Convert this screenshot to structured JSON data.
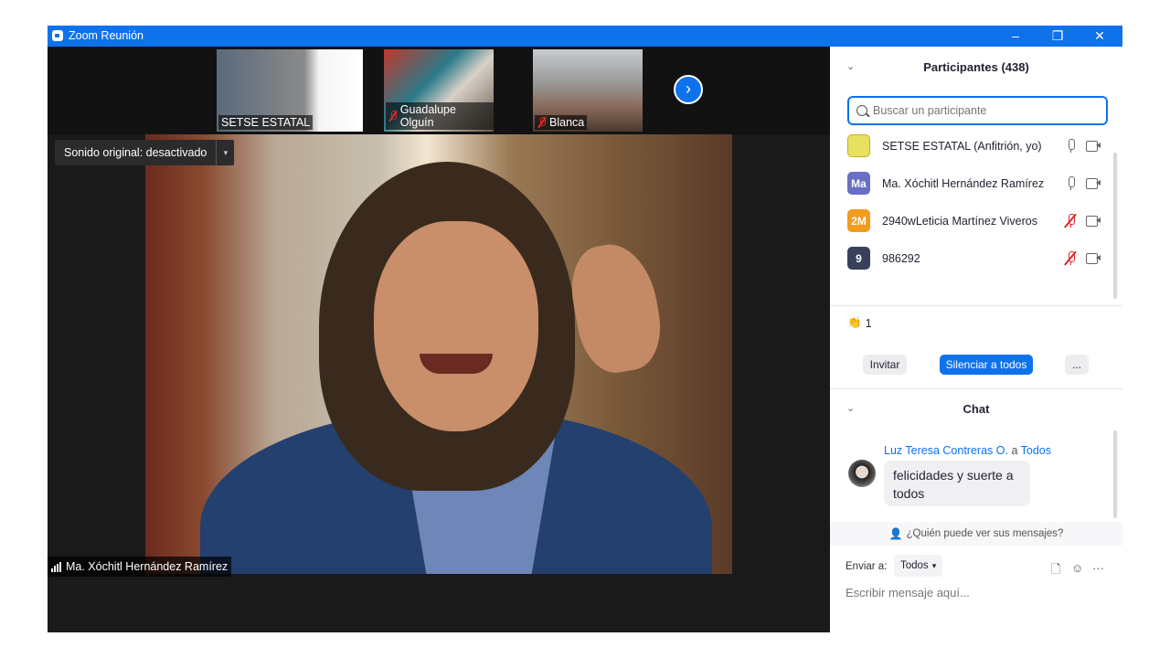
{
  "window": {
    "title": "Zoom Reunión",
    "minimize": "–",
    "maximize": "❐",
    "close": "✕"
  },
  "video": {
    "thumbnails": [
      {
        "name": "SETSE ESTATAL",
        "muted": false
      },
      {
        "name": "Guadalupe Olguín",
        "muted": true
      },
      {
        "name": "Blanca",
        "muted": true
      }
    ],
    "next_arrow": "›",
    "sound": {
      "label": "Sonido original: desactivado",
      "caret": "▾"
    },
    "speaker_name": "Ma. Xóchitl Hernández Ramírez"
  },
  "participants": {
    "title": "Participantes (438)",
    "collapse": "⌄",
    "search_placeholder": "Buscar un participante",
    "list": [
      {
        "initials": "",
        "name": "SETSE ESTATAL (Anfitrión, yo)",
        "color": "#e8e060",
        "muted": false
      },
      {
        "initials": "Ma",
        "name": "Ma. Xóchitl Hernández Ramírez",
        "color": "#6a6fc4",
        "muted": false
      },
      {
        "initials": "2M",
        "name": "2940wLeticia Martínez Viveros",
        "color": "#f29b1d",
        "muted": true
      },
      {
        "initials": "9",
        "name": "986292",
        "color": "#37415a",
        "muted": true
      }
    ],
    "reaction": {
      "emoji": "👏",
      "count": "1"
    },
    "buttons": {
      "invite": "Invitar",
      "mute_all": "Silenciar a todos",
      "more": "..."
    }
  },
  "chat": {
    "title": "Chat",
    "collapse": "⌄",
    "message": {
      "sender": "Luz Teresa Contreras O.",
      "to_word": "a",
      "recipient": "Todos",
      "text": "felicidades y suerte a todos"
    },
    "who_sees": "¿Quién puede ver sus mensajes?",
    "send_to_label": "Enviar a:",
    "send_to_value": "Todos",
    "input_placeholder": "Escribir mensaje aquí...",
    "tools": {
      "file": "🗋",
      "emoji": "☺",
      "more": "···"
    }
  }
}
